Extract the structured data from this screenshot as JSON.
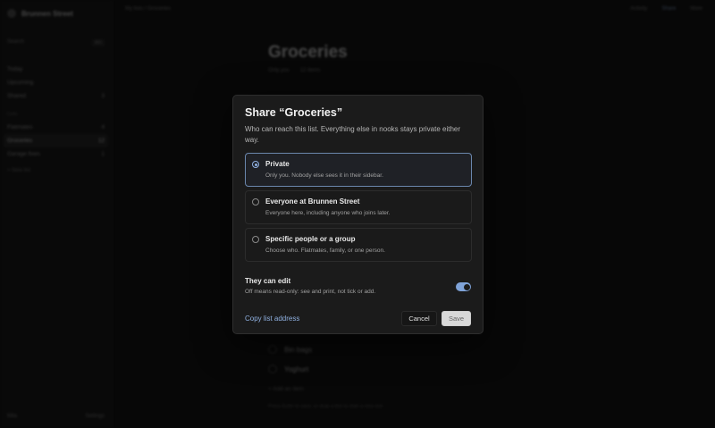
{
  "app": {
    "brand": "Brunnen Street",
    "search_label": "Search",
    "search_shortcut": "⌘K",
    "nav": [
      {
        "label": "Today",
        "count": ""
      },
      {
        "label": "Upcoming",
        "count": ""
      },
      {
        "label": "Shared",
        "count": "3"
      }
    ],
    "lists_section": "Lists",
    "lists": [
      {
        "label": "Flatmates",
        "count": "4"
      },
      {
        "label": "Groceries",
        "count": "12"
      },
      {
        "label": "Garage fixes",
        "count": "1"
      }
    ],
    "new_list": "+ New list",
    "footer_user": "Mila",
    "footer_settings": "Settings",
    "breadcrumb": "My lists / Groceries",
    "topbar_actions": [
      "Activity",
      "Share",
      "More"
    ],
    "page_title": "Groceries",
    "page_meta": [
      "Only you",
      "12 items"
    ],
    "rows": [
      "Bin bags",
      "Yoghurt"
    ],
    "add_item": "+ Add an item",
    "hint": "Press Enter to save, or drop a line to start a new one"
  },
  "dialog": {
    "title": "Share “Groceries”",
    "description": "Who can reach this list. Everything else in nooks stays private either way.",
    "options": [
      {
        "title": "Private",
        "desc": "Only you. Nobody else sees it in their sidebar.",
        "selected": true
      },
      {
        "title": "Everyone at Brunnen Street",
        "desc": "Everyone here, including anyone who joins later.",
        "selected": false
      },
      {
        "title": "Specific people or a group",
        "desc": "Choose who. Flatmates, family, or one person.",
        "selected": false
      }
    ],
    "edit": {
      "title": "They can edit",
      "desc": "Off means read-only: see and print, not tick or add.",
      "enabled": true
    },
    "copy_link": "Copy list address",
    "cancel": "Cancel",
    "save": "Save"
  },
  "colors": {
    "accent": "#8fb0e0",
    "toggle_on": "#7fa3d8",
    "dialog_bg": "#1b1b1b",
    "selected_border": "#6b87ad"
  }
}
